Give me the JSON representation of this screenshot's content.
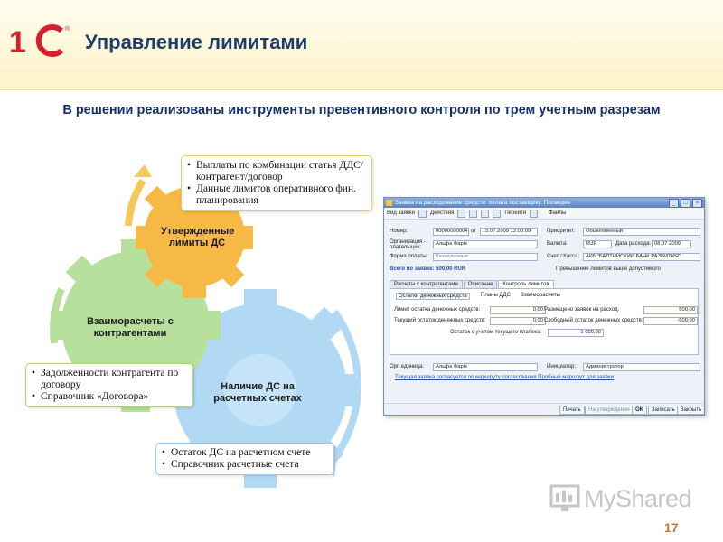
{
  "header": {
    "logo_text": "1С",
    "title": "Управление лимитами"
  },
  "subtitle": "В решении реализованы инструменты превентивного контроля по трем учетным разрезам",
  "diagram": {
    "gears": [
      {
        "label": "Утвержденные лимиты ДС",
        "color": "#f7b93e"
      },
      {
        "label": "Взаиморасчеты с контрагентами",
        "color": "#a9d88a"
      },
      {
        "label": "Наличие ДС на расчетных счетах",
        "color": "#a9d4f2"
      }
    ],
    "boxes": {
      "limits": [
        "Выплаты по комбинации статья ДДС/контрагент/договор",
        "Данные лимитов оперативного фин. планирования"
      ],
      "counterparty": [
        "Задолженности контрагента по договору",
        "Справочник «Договора»"
      ],
      "accounts": [
        "Остаток ДС на расчетном счете",
        "Справочник расчетные счета"
      ]
    }
  },
  "window": {
    "title": "Заявка на расходование средств: оплата поставщику. Проведен",
    "toolbar": {
      "doc_type": "Вид заявки",
      "actions": "Действия",
      "goto": "Перейти",
      "files": "Файлы"
    },
    "labels": {
      "number": "Номер:",
      "from": "от",
      "priority": "Приоритет:",
      "organization": "Организация - плательщик:",
      "currency": "Валюта:",
      "expense_date": "Дата расхода:",
      "payment_form": "Форма оплаты:",
      "account": "Счет / Касса:",
      "total": "Всего по заявке: 500,00 RUR",
      "limit_exceeded": "Превышение лимитов выше допустимого",
      "org_unit": "Орг. единица:",
      "initiator": "Инициатор:",
      "approval_note": "Текущая заявка согласуется по маршруту согласования Пробный маршрут для заявки"
    },
    "values": {
      "number": "00000000004",
      "date": "15.07.2009 12:00:09",
      "priority": "Обыкновенный",
      "organization": "Альфа Фарм",
      "currency": "RUR",
      "expense_date": "08.07.2009",
      "payment_form": "Безналичные",
      "account": "АКБ \"БАЛТИЙСКИЙ БАНК РАЗВИТИЯ\"",
      "org_unit": "Альфа Фарм",
      "initiator": "Администратор"
    },
    "tabs": [
      "Расчеты с контрагентами",
      "Описание",
      "Контроль лимитов"
    ],
    "subtabs": [
      "Остатки денежных средств",
      "Планы ДДС",
      "Взаиморасчеты"
    ],
    "limits": {
      "cash_limit_label": "Лимит остатка денежных средств:",
      "cash_limit": "0,00",
      "current_cash_label": "Текущий остаток денежных средств:",
      "current_cash": "0,00",
      "after_payment_label": "Остаток с учетом текущего платежа:",
      "after_payment": "-1 000,00",
      "placed_label": "Размещено заявок на расход:",
      "placed": "500,00",
      "free_cash_label": "Свободный остаток денежных средств:",
      "free_cash": "-500,00"
    },
    "buttons": {
      "print": "Печать",
      "approval": "На утверждении",
      "ok": "OK",
      "save": "Записать",
      "close": "Закрыть"
    }
  },
  "watermark": "MyShared",
  "page_number": "17"
}
